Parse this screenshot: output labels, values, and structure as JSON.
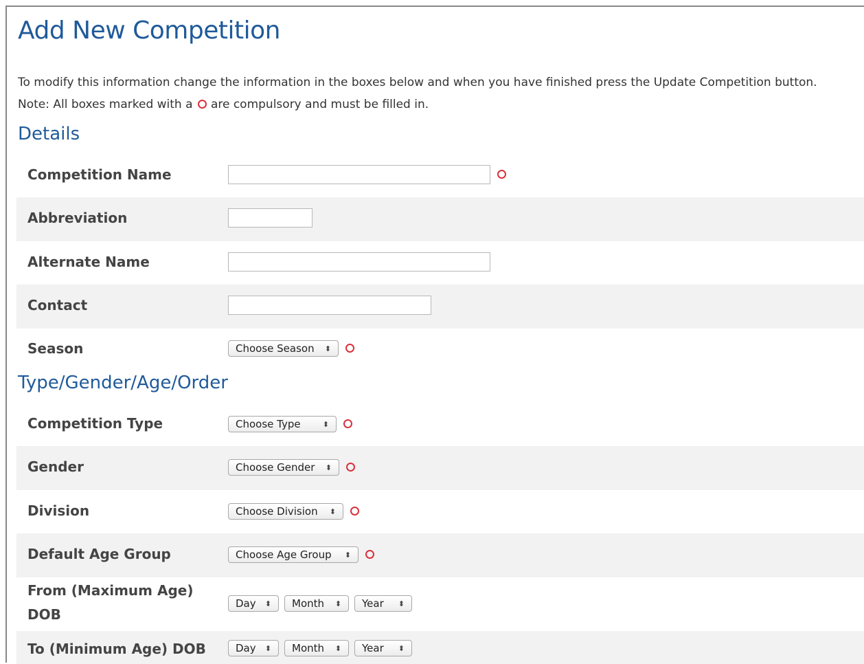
{
  "page": {
    "title": "Add New Competition",
    "intro_line1": "To modify this information change the information in the boxes below and when you have finished press the Update Competition button.",
    "intro_line2_pre": "Note: All boxes marked with a",
    "intro_line2_post": "are compulsory and must be filled in."
  },
  "sections": {
    "details": "Details",
    "type": "Type/Gender/Age/Order"
  },
  "fields": {
    "competition_name": {
      "label": "Competition Name",
      "value": ""
    },
    "abbreviation": {
      "label": "Abbreviation",
      "value": ""
    },
    "alternate_name": {
      "label": "Alternate Name",
      "value": ""
    },
    "contact": {
      "label": "Contact",
      "value": ""
    },
    "season": {
      "label": "Season",
      "selected": "Choose Season"
    },
    "competition_type": {
      "label": "Competition Type",
      "selected": "Choose Type"
    },
    "gender": {
      "label": "Gender",
      "selected": "Choose Gender"
    },
    "division": {
      "label": "Division",
      "selected": "Choose Division"
    },
    "age_group": {
      "label": "Default Age Group",
      "selected": "Choose Age Group"
    },
    "from_dob": {
      "label_line1": "From (Maximum Age)",
      "label_line2": "DOB",
      "day": "Day",
      "month": "Month",
      "year": "Year"
    },
    "to_dob": {
      "label": "To (Minimum Age) DOB",
      "day": "Day",
      "month": "Month",
      "year": "Year"
    }
  },
  "icons": {
    "required": "required-circle-icon",
    "select_arrow": "updown-arrow-icon"
  },
  "colors": {
    "heading": "#1f5a9a",
    "required": "#d9303a",
    "row_shade": "#f2f2f2"
  }
}
